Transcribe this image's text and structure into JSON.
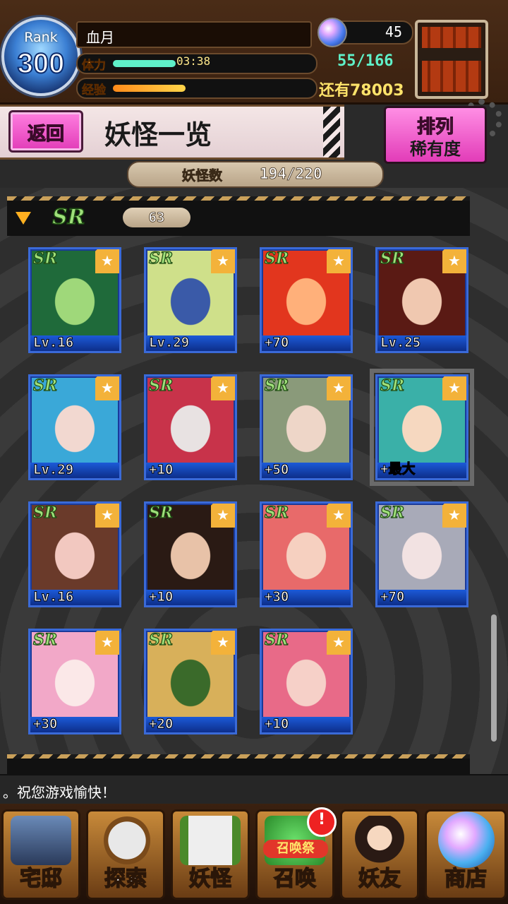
{
  "player": {
    "rank_label": "Rank",
    "rank": "300",
    "name": "血月",
    "stamina_label": "体力",
    "stamina_timer": "03:38",
    "stamina_fill": 0.33,
    "stamina_value": "55/166",
    "exp_label": "经验",
    "exp_fill": 0.38,
    "exp_remaining": "还有78003",
    "gems": "45"
  },
  "header": {
    "back_label": "返回",
    "title": "妖怪一览",
    "sort_line1": "排列",
    "sort_line2": "稀有度"
  },
  "summary": {
    "count_label": "妖怪数",
    "count_value": "194/220"
  },
  "group": {
    "rarity": "SR",
    "count": "63"
  },
  "cards": [
    {
      "level": "Lv.16",
      "rarity": "SR",
      "colors": [
        "#1f6a3a",
        "#9fd87a"
      ]
    },
    {
      "level": "Lv.29",
      "rarity": "SR",
      "colors": [
        "#cfe08a",
        "#3a5aa8"
      ]
    },
    {
      "level": "+70",
      "rarity": "SR",
      "colors": [
        "#e2361e",
        "#ffb07a"
      ]
    },
    {
      "level": "Lv.25",
      "rarity": "SR",
      "colors": [
        "#5a1a14",
        "#f0c8b0"
      ]
    },
    {
      "level": "Lv.29",
      "rarity": "SR",
      "colors": [
        "#3aa8d8",
        "#f2d8d0"
      ]
    },
    {
      "level": "+10",
      "rarity": "SR",
      "colors": [
        "#c8334a",
        "#e8e2e2"
      ]
    },
    {
      "level": "+50",
      "rarity": "SR",
      "colors": [
        "#8a9a7a",
        "#eed6c8"
      ]
    },
    {
      "level": "+最大",
      "rarity": "SR",
      "colors": [
        "#3ab0a8",
        "#f6d8c0"
      ]
    },
    {
      "level": "Lv.16",
      "rarity": "SR",
      "colors": [
        "#6a3a2a",
        "#f2c8c0"
      ]
    },
    {
      "level": "+10",
      "rarity": "SR",
      "colors": [
        "#2a1a14",
        "#e8c2a8"
      ]
    },
    {
      "level": "+30",
      "rarity": "SR",
      "colors": [
        "#e86a6a",
        "#f6d0c0"
      ]
    },
    {
      "level": "+70",
      "rarity": "SR",
      "colors": [
        "#a8aab8",
        "#f2e2e2"
      ]
    },
    {
      "level": "+30",
      "rarity": "SR",
      "colors": [
        "#f2a8c8",
        "#fbe8e8"
      ]
    },
    {
      "level": "+20",
      "rarity": "SR",
      "colors": [
        "#d8b05a",
        "#3a6a2a"
      ]
    },
    {
      "level": "+10",
      "rarity": "SR",
      "colors": [
        "#e86a88",
        "#f6d0c8"
      ]
    }
  ],
  "ticker": {
    "text": "。祝您游戏愉快！"
  },
  "nav": {
    "items": [
      {
        "label": "宅邸",
        "icon": "house-icon"
      },
      {
        "label": "探索",
        "icon": "magnifier-icon"
      },
      {
        "label": "妖怪",
        "icon": "scroll-icon"
      },
      {
        "label": "召唤",
        "icon": "summon-icon",
        "event": "召唤祭",
        "badge": "!"
      },
      {
        "label": "妖友",
        "icon": "friend-icon"
      },
      {
        "label": "商店",
        "icon": "orb-icon"
      }
    ]
  },
  "colors": {
    "accent_pink": "#e23cb8",
    "sr_green": "#9fe07a",
    "card_blue": "#1a3a9a",
    "stamina_teal": "#5ff0c8",
    "exp_yellow": "#ffe36a"
  }
}
